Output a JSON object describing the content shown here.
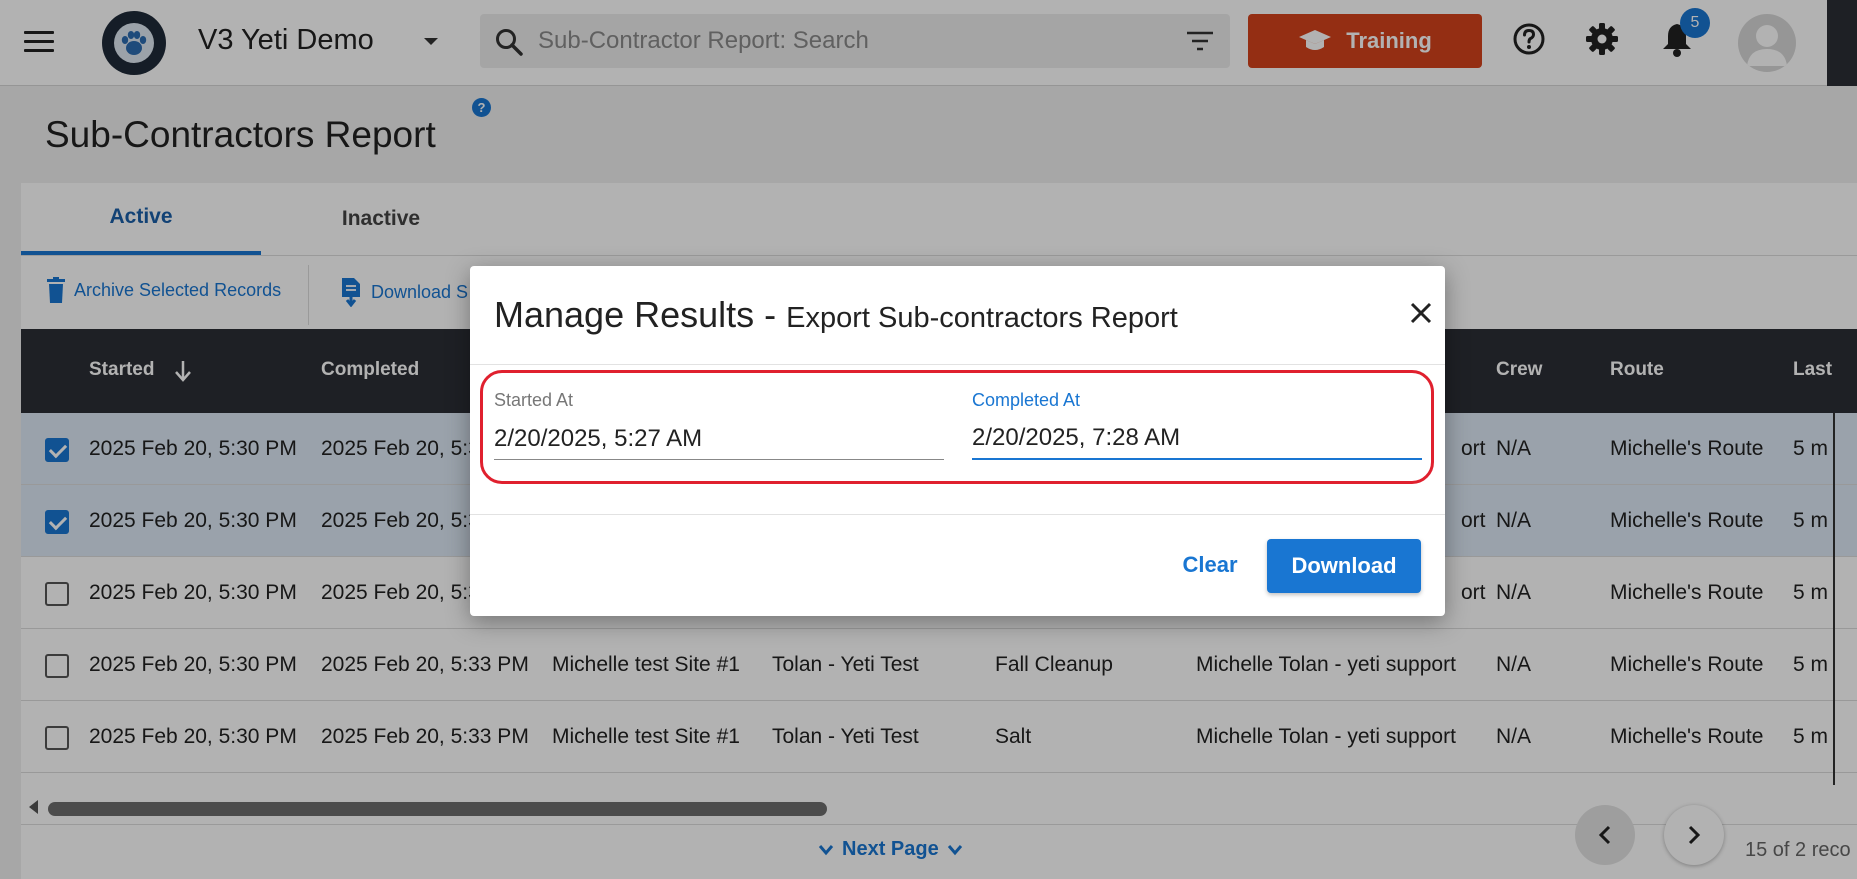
{
  "app": {
    "title": "V3 Yeti Demo",
    "brand_color": "#1f2a38"
  },
  "search": {
    "placeholder": "Sub-Contractor Report: Search"
  },
  "header": {
    "training_label": "Training",
    "training_color": "#d4431c",
    "notification_count": "5"
  },
  "page": {
    "title": "Sub-Contractors Report",
    "help": "?"
  },
  "tabs": [
    {
      "label": "Active",
      "active": true
    },
    {
      "label": "Inactive",
      "active": false
    }
  ],
  "actions": {
    "archive_label": "Archive Selected Records",
    "download_label": "Download S"
  },
  "table": {
    "columns": [
      "Started",
      "Completed",
      "Crew",
      "Route",
      "Last"
    ],
    "rows": [
      {
        "checked": true,
        "started": "2025 Feb 20, 5:30 PM",
        "completed": "2025 Feb 20, 5:3",
        "site": "",
        "customer": "",
        "service": "",
        "contractor": "ort",
        "crew": "N/A",
        "route": "Michelle's Route",
        "last": "5 m"
      },
      {
        "checked": true,
        "started": "2025 Feb 20, 5:30 PM",
        "completed": "2025 Feb 20, 5:3",
        "site": "",
        "customer": "",
        "service": "",
        "contractor": "ort",
        "crew": "N/A",
        "route": "Michelle's Route",
        "last": "5 m"
      },
      {
        "checked": false,
        "started": "2025 Feb 20, 5:30 PM",
        "completed": "2025 Feb 20, 5:3",
        "site": "",
        "customer": "",
        "service": "",
        "contractor": "ort",
        "crew": "N/A",
        "route": "Michelle's Route",
        "last": "5 m"
      },
      {
        "checked": false,
        "started": "2025 Feb 20, 5:30 PM",
        "completed": "2025 Feb 20, 5:33 PM",
        "site": "Michelle test Site #1",
        "customer": "Tolan - Yeti Test",
        "service": "Fall Cleanup",
        "contractor": "Michelle Tolan - yeti support",
        "crew": "N/A",
        "route": "Michelle's Route",
        "last": "5 m"
      },
      {
        "checked": false,
        "started": "2025 Feb 20, 5:30 PM",
        "completed": "2025 Feb 20, 5:33 PM",
        "site": "Michelle test Site #1",
        "customer": "Tolan - Yeti Test",
        "service": "Salt",
        "contractor": "Michelle Tolan - yeti support",
        "crew": "N/A",
        "route": "Michelle's Route",
        "last": "5 m"
      }
    ]
  },
  "pagination": {
    "next_label": "Next Page",
    "info": "15 of 2 reco"
  },
  "modal": {
    "title": "Manage Results",
    "separator": " - ",
    "subtitle": "Export Sub-contractors Report",
    "started_label": "Started At",
    "started_value": "2/20/2025, 5:27 AM",
    "completed_label": "Completed At",
    "completed_value": "2/20/2025, 7:28 AM",
    "clear_label": "Clear",
    "download_label": "Download",
    "highlight_color": "#e0202e",
    "accent_color": "#1976d2"
  }
}
